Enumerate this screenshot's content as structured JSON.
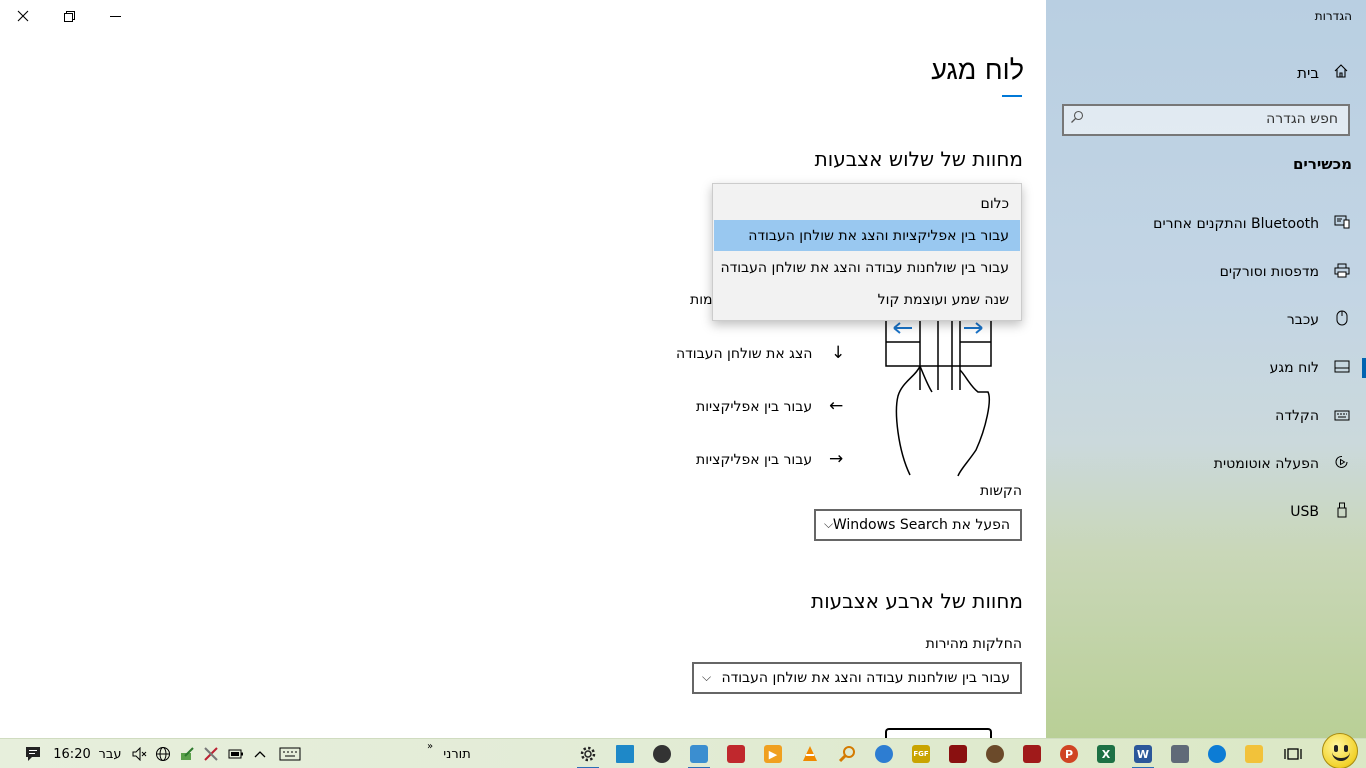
{
  "window": {
    "title": "הגדרות",
    "controls": {
      "close_icon": "close-icon",
      "restore_icon": "restore-icon",
      "minimize_icon": "minimize-icon"
    }
  },
  "sidebar": {
    "home_label": "בית",
    "search_placeholder": "חפש הגדרה",
    "section": "מכשירים",
    "items": [
      {
        "label": "Bluetooth והתקנים אחרים",
        "icon": "bluetooth-devices-icon"
      },
      {
        "label": "מדפסות וסורקים",
        "icon": "printer-icon"
      },
      {
        "label": "עכבר",
        "icon": "mouse-icon"
      },
      {
        "label": "לוח מגע",
        "icon": "touchpad-icon",
        "active": true
      },
      {
        "label": "הקלדה",
        "icon": "keyboard-icon"
      },
      {
        "label": "הפעלה אוטומטית",
        "icon": "autoplay-icon"
      },
      {
        "label": "USB",
        "icon": "usb-icon"
      }
    ]
  },
  "main": {
    "page_title": "לוח מגע",
    "three_finger": {
      "title": "מחוות של שלוש אצבעות",
      "partial_label": "מות",
      "gestures": [
        {
          "label": "הצג את שולחן העבודה",
          "arrow": "↓"
        },
        {
          "label": "עבור בין אפליקציות",
          "arrow": "←"
        },
        {
          "label": "עבור בין אפליקציות",
          "arrow": "→"
        }
      ],
      "taps_label": "הקשות",
      "taps_value": "הפעל את Windows Search"
    },
    "four_finger": {
      "title": "מחוות של ארבע אצבעות",
      "swipes_label": "החלקות מהירות",
      "swipes_value": "עבור בין שולחנות עבודה והצג את שולחן העבודה"
    },
    "dropdown": {
      "options": [
        "כלום",
        "עבור בין אפליקציות והצג את שולחן העבודה",
        "עבור בין שולחנות עבודה והצג את שולחן העבודה",
        "שנה שמע ועוצמת קול"
      ],
      "selected_index": 1
    }
  },
  "taskbar": {
    "time": "16:20",
    "language": "עבר",
    "toolbar_label": "תורני",
    "toolbar_chevron": "»",
    "apps": [
      "settings",
      "desktop",
      "app",
      "app",
      "app",
      "media-player",
      "vlc",
      "search-tool",
      "app",
      "app",
      "app",
      "app",
      "app",
      "powerpoint",
      "excel",
      "word",
      "calculator",
      "edge",
      "file-explorer",
      "task-view"
    ],
    "colors": {
      "powerpoint": "#d04423",
      "excel": "#1d7044",
      "word": "#2b579a",
      "edge": "#0c7cd5",
      "accent": "#0078d7"
    }
  }
}
